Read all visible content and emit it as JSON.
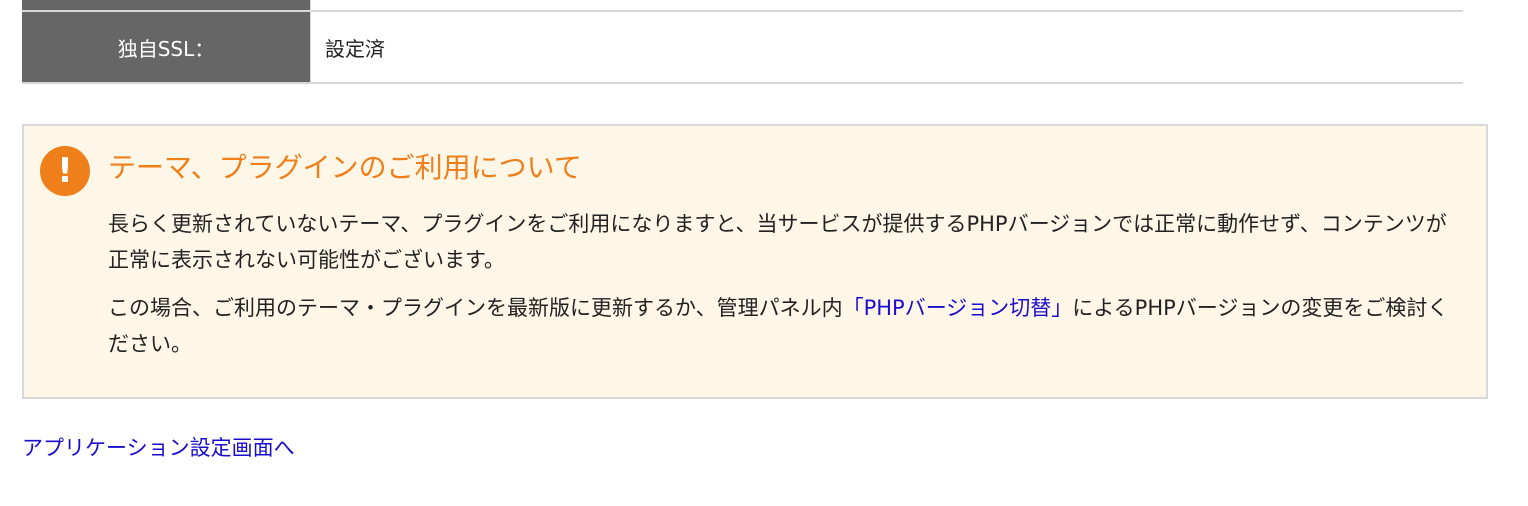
{
  "ssl_row": {
    "label": "独自SSL：",
    "value": "設定済"
  },
  "notice": {
    "icon": "exclamation-icon",
    "icon_glyph": "!",
    "title": "テーマ、プラグインのご利用について",
    "paragraph1": "長らく更新されていないテーマ、プラグインをご利用になりますと、当サービスが提供するPHPバージョンでは正常に動作せず、コンテンツが正常に表示されない可能性がございます。",
    "paragraph2_before": "この場合、ご利用のテーマ・プラグインを最新版に更新するか、管理パネル内",
    "paragraph2_link": "「PHPバージョン切替」",
    "paragraph2_after": "によるPHPバージョンの変更をご検討ください。"
  },
  "app_settings_link": "アプリケーション設定画面へ",
  "colors": {
    "header_bg": "#666666",
    "accent_orange": "#ee7f1a",
    "notice_bg": "#fef7e8",
    "link": "#1a0dcc"
  }
}
